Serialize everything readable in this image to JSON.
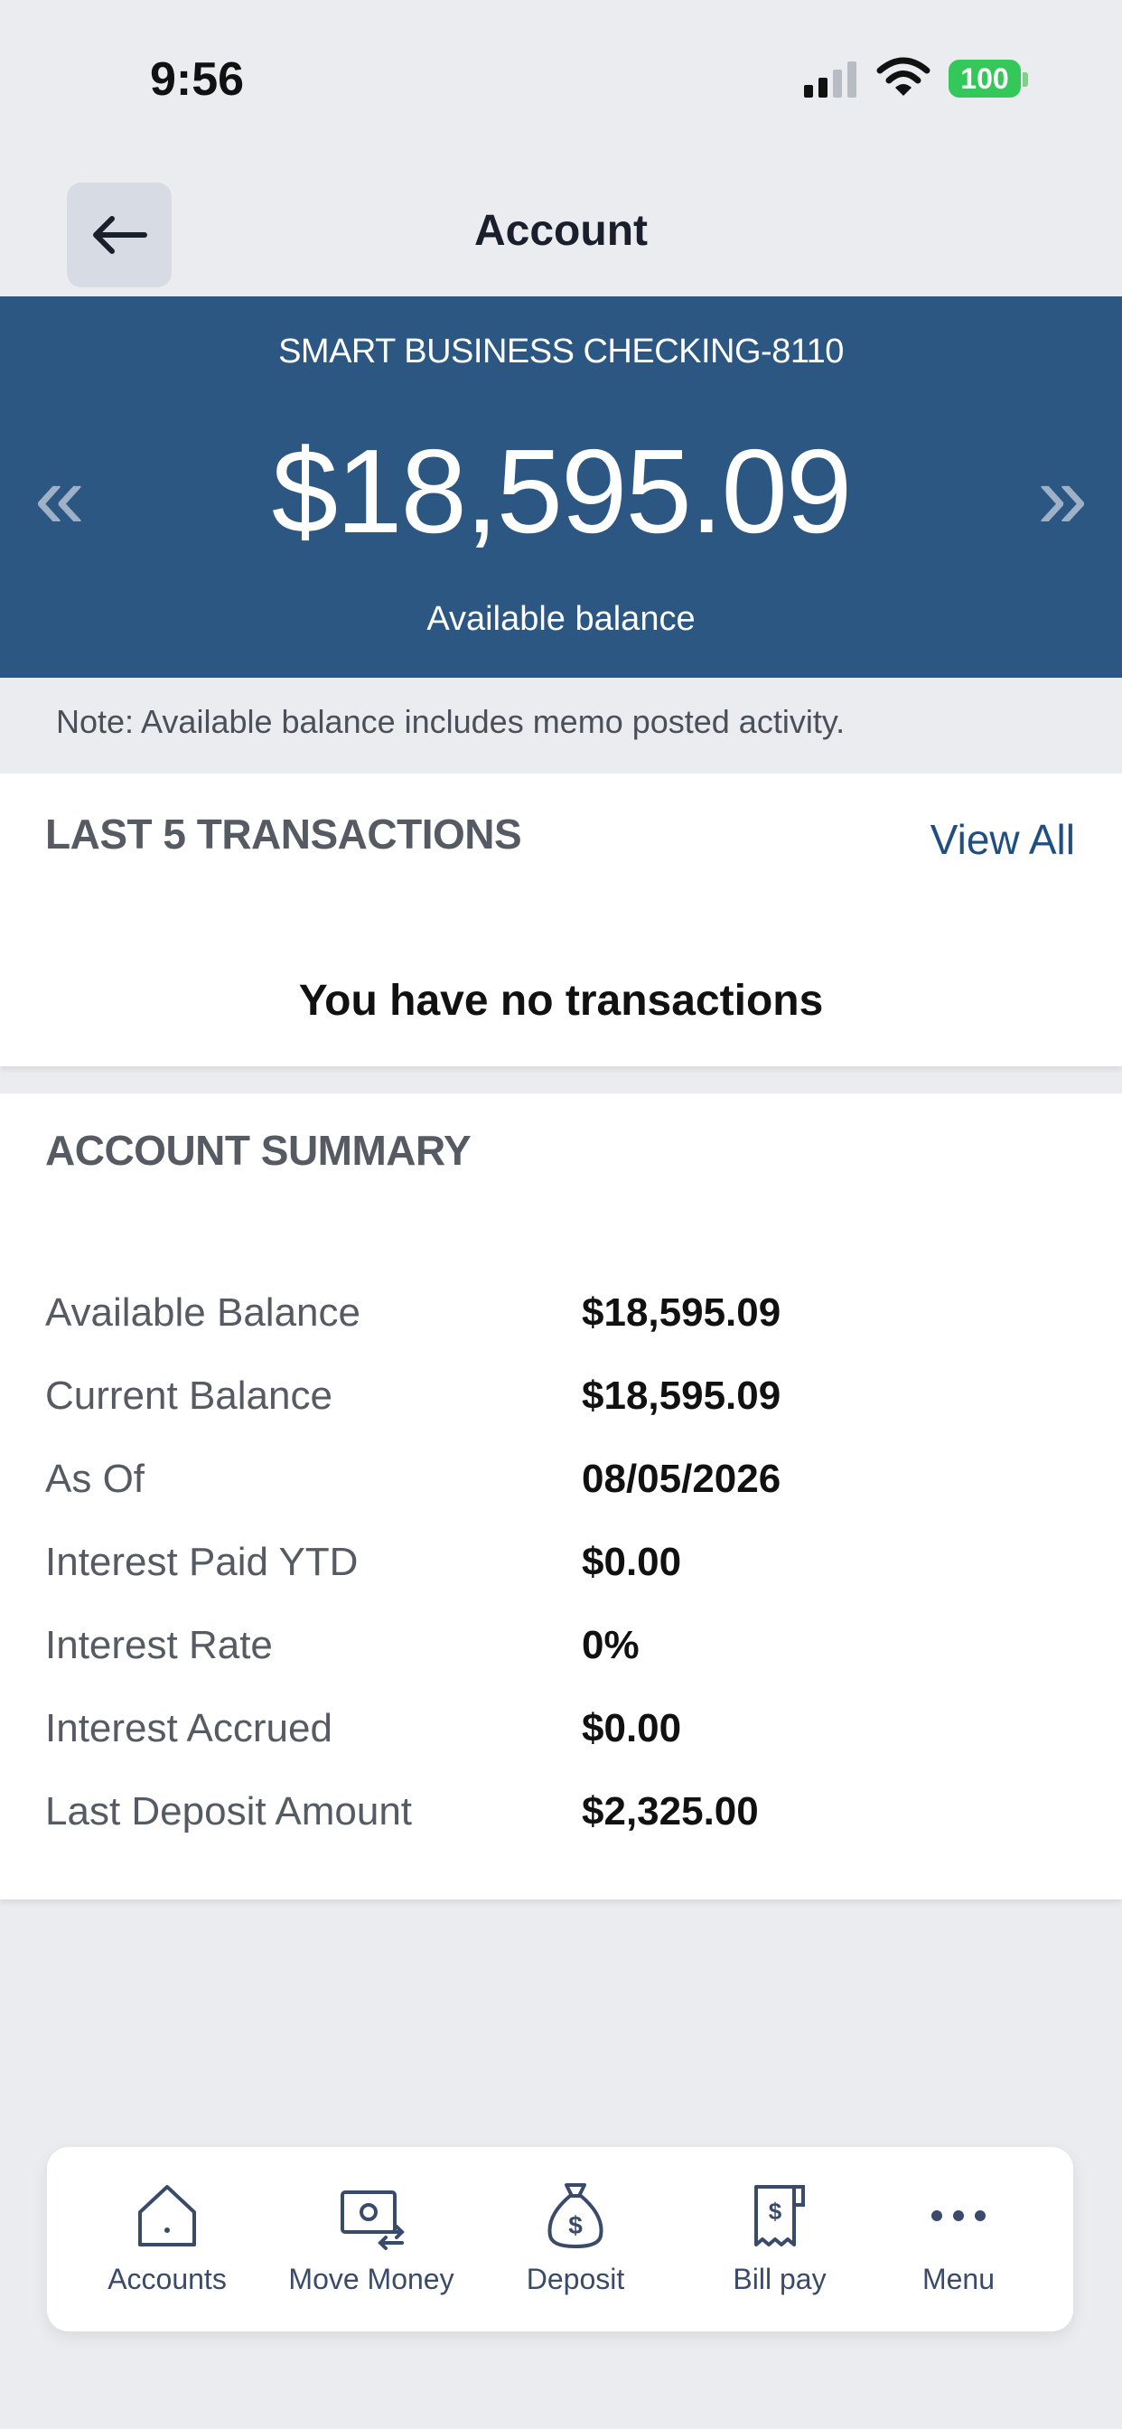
{
  "status_bar": {
    "time": "9:56",
    "battery": "100"
  },
  "nav": {
    "title": "Account"
  },
  "account": {
    "name": "SMART BUSINESS CHECKING-8110",
    "balance": "$18,595.09",
    "balance_label": "Available balance",
    "prev_glyph": "«",
    "next_glyph": "»"
  },
  "note": "Note: Available balance includes memo posted activity.",
  "transactions": {
    "title": "LAST 5 TRANSACTIONS",
    "view_all": "View All",
    "empty_message": "You have no transactions"
  },
  "summary": {
    "title": "ACCOUNT SUMMARY",
    "rows": [
      {
        "label": "Available Balance",
        "value": "$18,595.09"
      },
      {
        "label": "Current Balance",
        "value": "$18,595.09"
      },
      {
        "label": "As Of",
        "value": "08/05/2026"
      },
      {
        "label": "Interest Paid YTD",
        "value": "$0.00"
      },
      {
        "label": "Interest Rate",
        "value": "0%"
      },
      {
        "label": "Interest Accrued",
        "value": "$0.00"
      },
      {
        "label": "Last Deposit Amount",
        "value": "$2,325.00"
      }
    ]
  },
  "tabbar": {
    "items": [
      {
        "label": "Accounts",
        "icon": "home-icon"
      },
      {
        "label": "Move Money",
        "icon": "move-money-icon"
      },
      {
        "label": "Deposit",
        "icon": "money-bag-icon"
      },
      {
        "label": "Bill pay",
        "icon": "bill-icon"
      },
      {
        "label": "Menu",
        "icon": "more-dots-icon"
      }
    ]
  },
  "colors": {
    "header_bg": "#2b5782",
    "link": "#1f4e82",
    "battery": "#34c759",
    "tab_icon": "#3a4a6b"
  }
}
